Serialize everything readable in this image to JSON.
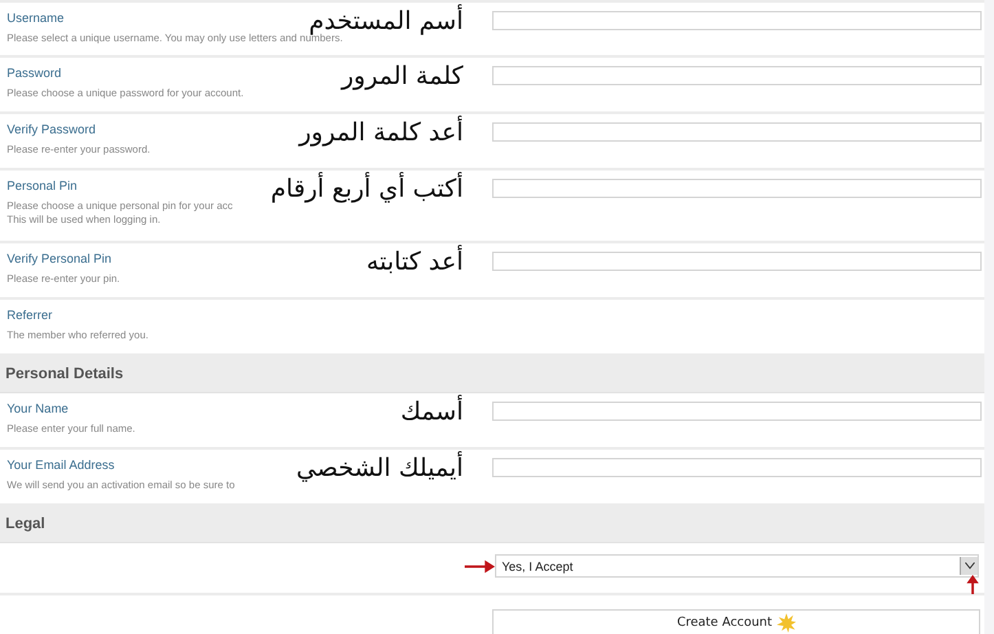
{
  "rows": [
    {
      "kind": "field",
      "label": "Username",
      "hint": [
        "Please select a unique username. You may only use letters and numbers."
      ],
      "annotation": "أسم المستخدم"
    },
    {
      "kind": "field",
      "label": "Password",
      "hint": [
        "Please choose a unique password for your account."
      ],
      "annotation": "كلمة المرور"
    },
    {
      "kind": "field",
      "label": "Verify Password",
      "hint": [
        "Please re-enter your password."
      ],
      "annotation": "أعد كلمة المرور"
    },
    {
      "kind": "field",
      "label": "Personal Pin",
      "hint": [
        "Please choose a unique personal pin for your acc",
        "This will be used when logging in."
      ],
      "annotation": "أكتب أي أربع أرقام"
    },
    {
      "kind": "field",
      "label": "Verify Personal Pin",
      "hint": [
        "Please re-enter your pin."
      ],
      "annotation": "أعد كتابته"
    },
    {
      "kind": "plain",
      "label": "Referrer",
      "hint": [
        "The member who referred you."
      ]
    },
    {
      "kind": "section",
      "title": "Personal Details"
    },
    {
      "kind": "field",
      "label": "Your Name",
      "hint": [
        "Please enter your full name."
      ],
      "annotation": "أسمك"
    },
    {
      "kind": "field",
      "label": "Your Email Address",
      "hint": [
        "We will send you an activation email so be sure to"
      ],
      "annotation": "أيميلك الشخصي"
    },
    {
      "kind": "section",
      "title": "Legal"
    },
    {
      "kind": "select",
      "value": "Yes, I Accept"
    },
    {
      "kind": "button",
      "label": "Create Account"
    }
  ]
}
